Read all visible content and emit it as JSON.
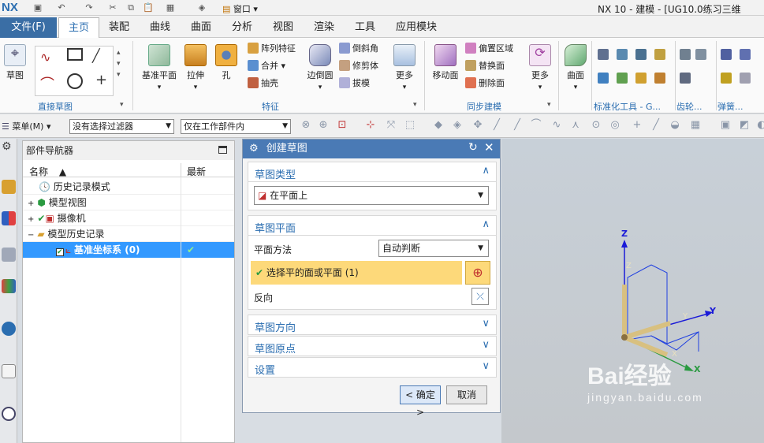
{
  "app": {
    "logo": "NX",
    "title": "NX 10 - 建模 - [UG10.0练习三维"
  },
  "quick_access": {
    "window_menu": "窗口"
  },
  "tabs": [
    "主页",
    "装配",
    "曲线",
    "曲面",
    "分析",
    "视图",
    "渲染",
    "工具",
    "应用模块"
  ],
  "file_tab": "文件(F)",
  "ribbon": {
    "sketch_group": {
      "sketch": "草图",
      "label": "直接草图"
    },
    "feature_group": {
      "datum_plane": "基准平面",
      "extrude": "拉伸",
      "hole": "孔",
      "pattern_feature": "阵列特征",
      "unite": "合并",
      "shell": "抽壳",
      "edge_blend": "边倒圆",
      "chamfer": "倒斜角",
      "trim_body": "修剪体",
      "draft": "拔模",
      "more": "更多",
      "label": "特征"
    },
    "sync_group": {
      "move_face": "移动面",
      "offset_region": "偏置区域",
      "replace_face": "替换面",
      "delete_face": "删除面",
      "more": "更多",
      "label": "同步建模"
    },
    "surface_group": {
      "surface": "曲面"
    },
    "standard_group": {
      "label": "标准化工具 - G..."
    },
    "gear_group": {
      "label": "齿轮..."
    },
    "spring_group": {
      "label": "弹簧..."
    }
  },
  "selbar": {
    "menu": "菜单(M)",
    "filter": "没有选择过滤器",
    "scope": "仅在工作部件内"
  },
  "navigator": {
    "title": "部件导航器",
    "col_name": "名称",
    "col_latest": "最新",
    "rows": [
      "历史记录模式",
      "模型视图",
      "摄像机",
      "模型历史记录",
      "基准坐标系 (0)"
    ]
  },
  "dialog": {
    "title": "创建草图",
    "sketch_type": {
      "title": "草图类型",
      "value": "在平面上"
    },
    "sketch_plane": {
      "title": "草图平面",
      "method_label": "平面方法",
      "method_value": "自动判断",
      "select_text": "选择平的面或平面 (1)",
      "reverse_label": "反向"
    },
    "sketch_orientation": "草图方向",
    "sketch_origin": "草图原点",
    "settings": "设置",
    "ok": "< 确定 >",
    "cancel": "取消"
  },
  "viewport": {
    "axis_z": "Z",
    "axis_y": "Y",
    "axis_x": "X",
    "watermark_brand": "Bai经验",
    "watermark_url": "jingyan.baidu.com"
  }
}
